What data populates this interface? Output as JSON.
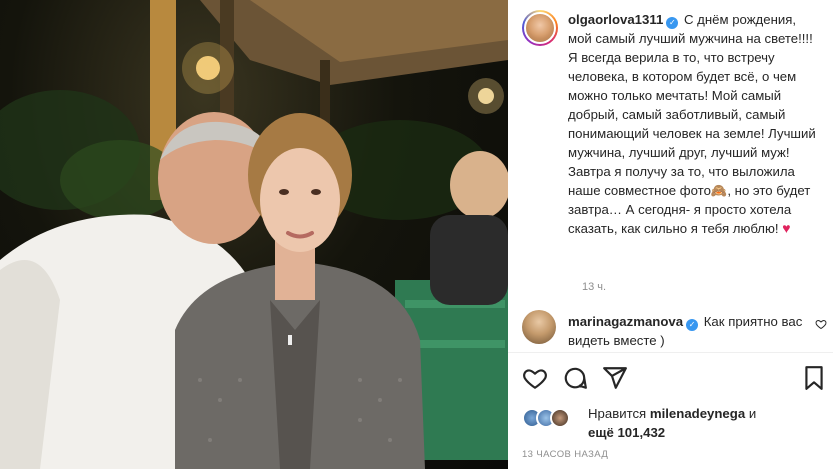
{
  "post": {
    "username": "olgaorlova1311",
    "caption": "С днём рождения, мой самый лучший мужчина на свете!!!! Я всегда верила в то, что встречу человека, в котором будет всё, о чем можно только мечтать! Мой самый добрый, самый заботливый, самый понимающий человек на земле! Лучший мужчина, лучший друг, лучший муж! Завтра я получу за то, что выложила наше совместное фото",
    "caption_emoji_1": "🙈",
    "caption_cont": ", но это будет завтра… А сегодня- я просто хотела сказать, как сильно я тебя люблю!",
    "caption_emoji_2": "♥",
    "time_ago": "13 ч."
  },
  "comment": {
    "username": "marinagazmanova",
    "text": "Как приятно вас видеть вместе )"
  },
  "actions": {
    "like_icon": "heart-icon",
    "comment_icon": "comment-icon",
    "share_icon": "share-icon",
    "save_icon": "bookmark-icon"
  },
  "likes": {
    "prefix": "Нравится",
    "liker": "milenadeynega",
    "joiner": "и",
    "count_text": "ещё 101,432"
  },
  "timestamp": "13 ЧАСОВ НАЗАД",
  "colors": {
    "verified": "#3897f0",
    "heart": "#e0245e",
    "muted": "#8e8e8e"
  }
}
